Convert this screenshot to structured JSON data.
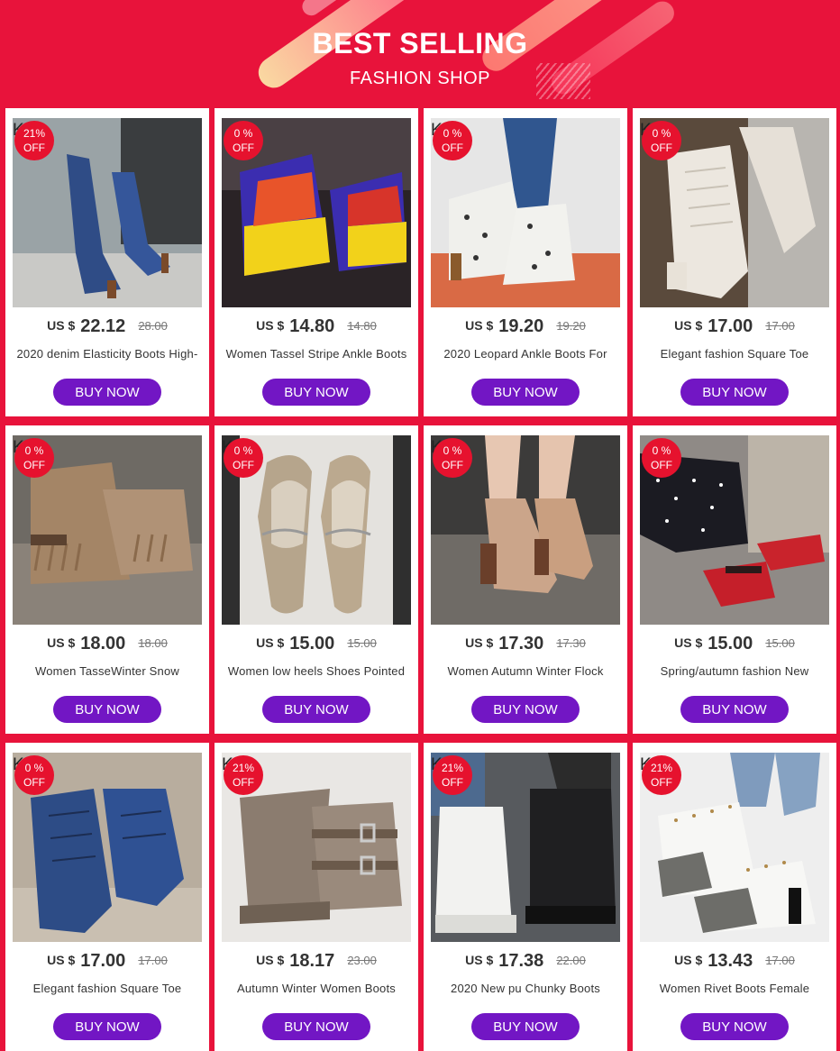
{
  "banner": {
    "title": "BEST SELLING",
    "subtitle": "FASHION SHOP"
  },
  "products": [
    {
      "brand": "KG",
      "discount": "21%",
      "off": "OFF",
      "currency": "US $",
      "price": "22.12",
      "old_price": "28.00",
      "name": "2020 denim Elasticity Boots High-",
      "button": "BUY NOW",
      "image": "denim-over-knee-boot"
    },
    {
      "brand": "",
      "discount": "0 %",
      "off": "OFF",
      "currency": "US $",
      "price": "14.80",
      "old_price": "14.80",
      "name": "Women Tassel Stripe Ankle Boots",
      "button": "BUY NOW",
      "image": "tassel-stripe-ankle-boot"
    },
    {
      "brand": "KG",
      "discount": "0 %",
      "off": "OFF",
      "currency": "US $",
      "price": "19.20",
      "old_price": "19.20",
      "name": "2020 Leopard Ankle Boots For",
      "button": "BUY NOW",
      "image": "leopard-ankle-boot"
    },
    {
      "brand": "KG",
      "discount": "0 %",
      "off": "OFF",
      "currency": "US $",
      "price": "17.00",
      "old_price": "17.00",
      "name": "Elegant fashion Square Toe",
      "button": "BUY NOW",
      "image": "white-lace-up-boot"
    },
    {
      "brand": "KG",
      "discount": "0 %",
      "off": "OFF",
      "currency": "US $",
      "price": "18.00",
      "old_price": "18.00",
      "name": "Women      TasseWinter      Snow",
      "button": "BUY NOW",
      "image": "fringe-suede-boot"
    },
    {
      "brand": "KG",
      "discount": "0 %",
      "off": "OFF",
      "currency": "US $",
      "price": "15.00",
      "old_price": "15.00",
      "name": "Women low heels Shoes  Pointed",
      "button": "BUY NOW",
      "image": "pointed-flat-shoe"
    },
    {
      "brand": "KG",
      "discount": "0 %",
      "off": "OFF",
      "currency": "US $",
      "price": "17.30",
      "old_price": "17.30",
      "name": "Women Autumn Winter Flock",
      "button": "BUY NOW",
      "image": "flock-ankle-boot"
    },
    {
      "brand": "",
      "discount": "0 %",
      "off": "OFF",
      "currency": "US $",
      "price": "15.00",
      "old_price": "15.00",
      "name": "Spring/autumn      fashion New",
      "button": "BUY NOW",
      "image": "red-mary-jane"
    },
    {
      "brand": "KG",
      "discount": "0 %",
      "off": "OFF",
      "currency": "US $",
      "price": "17.00",
      "old_price": "17.00",
      "name": "Elegant fashion Square Toe",
      "button": "BUY NOW",
      "image": "blue-lace-up-boot"
    },
    {
      "brand": "KG",
      "discount": "21%",
      "off": "OFF",
      "currency": "US $",
      "price": "18.17",
      "old_price": "23.00",
      "name": "Autumn Winter Women Boots",
      "button": "BUY NOW",
      "image": "buckle-wedge-boot"
    },
    {
      "brand": "KG",
      "discount": "21%",
      "off": "OFF",
      "currency": "US $",
      "price": "17.38",
      "old_price": "22.00",
      "name": "2020 New pu Chunky Boots",
      "button": "BUY NOW",
      "image": "chunky-combat-boot"
    },
    {
      "brand": "KG",
      "discount": "21%",
      "off": "OFF",
      "currency": "US $",
      "price": "13.43",
      "old_price": "17.00",
      "name": "Women Rivet Boots Female",
      "button": "BUY NOW",
      "image": "snake-rivet-boot"
    }
  ]
}
